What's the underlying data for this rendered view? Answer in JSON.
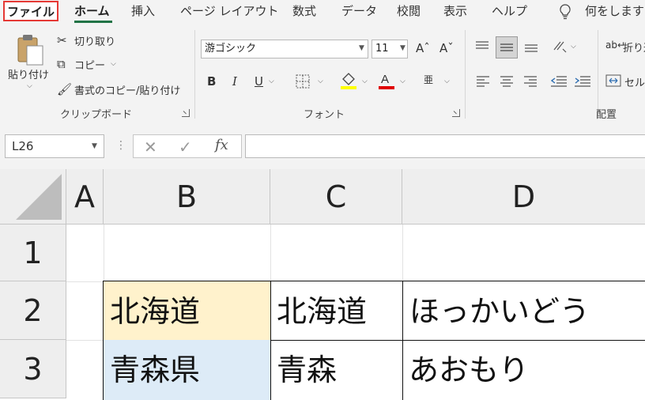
{
  "menu": {
    "tabs": [
      "ファイル",
      "ホーム",
      "挿入",
      "ページ レイアウト",
      "数式",
      "データ",
      "校閲",
      "表示",
      "ヘルプ"
    ],
    "tell_me": "何をしますか"
  },
  "clipboard": {
    "paste": "貼り付け",
    "cut": "切り取り",
    "copy": "コピー",
    "format_painter": "書式のコピー/貼り付け",
    "group_label": "クリップボード"
  },
  "font": {
    "name": "游ゴシック",
    "size": "11",
    "bold": "B",
    "italic": "I",
    "underline": "U",
    "group_label": "フォント",
    "font_color": "#e00000",
    "fill_color": "#ffff00"
  },
  "alignment": {
    "wrap_text": "折り返",
    "merge": "セル",
    "group_label": "配置"
  },
  "formula_bar": {
    "name_box": "L26",
    "fx": "fx",
    "formula": ""
  },
  "sheet": {
    "columns": [
      "A",
      "B",
      "C",
      "D"
    ],
    "rows": [
      "1",
      "2",
      "3"
    ],
    "cells": {
      "B2": "北海道",
      "C2": "北海道",
      "D2": "ほっかいどう",
      "B3": "青森県",
      "C3": "青森",
      "D3": "あおもり"
    },
    "fill_b2": "#fff2cc",
    "fill_b3": "#ddebf7"
  }
}
